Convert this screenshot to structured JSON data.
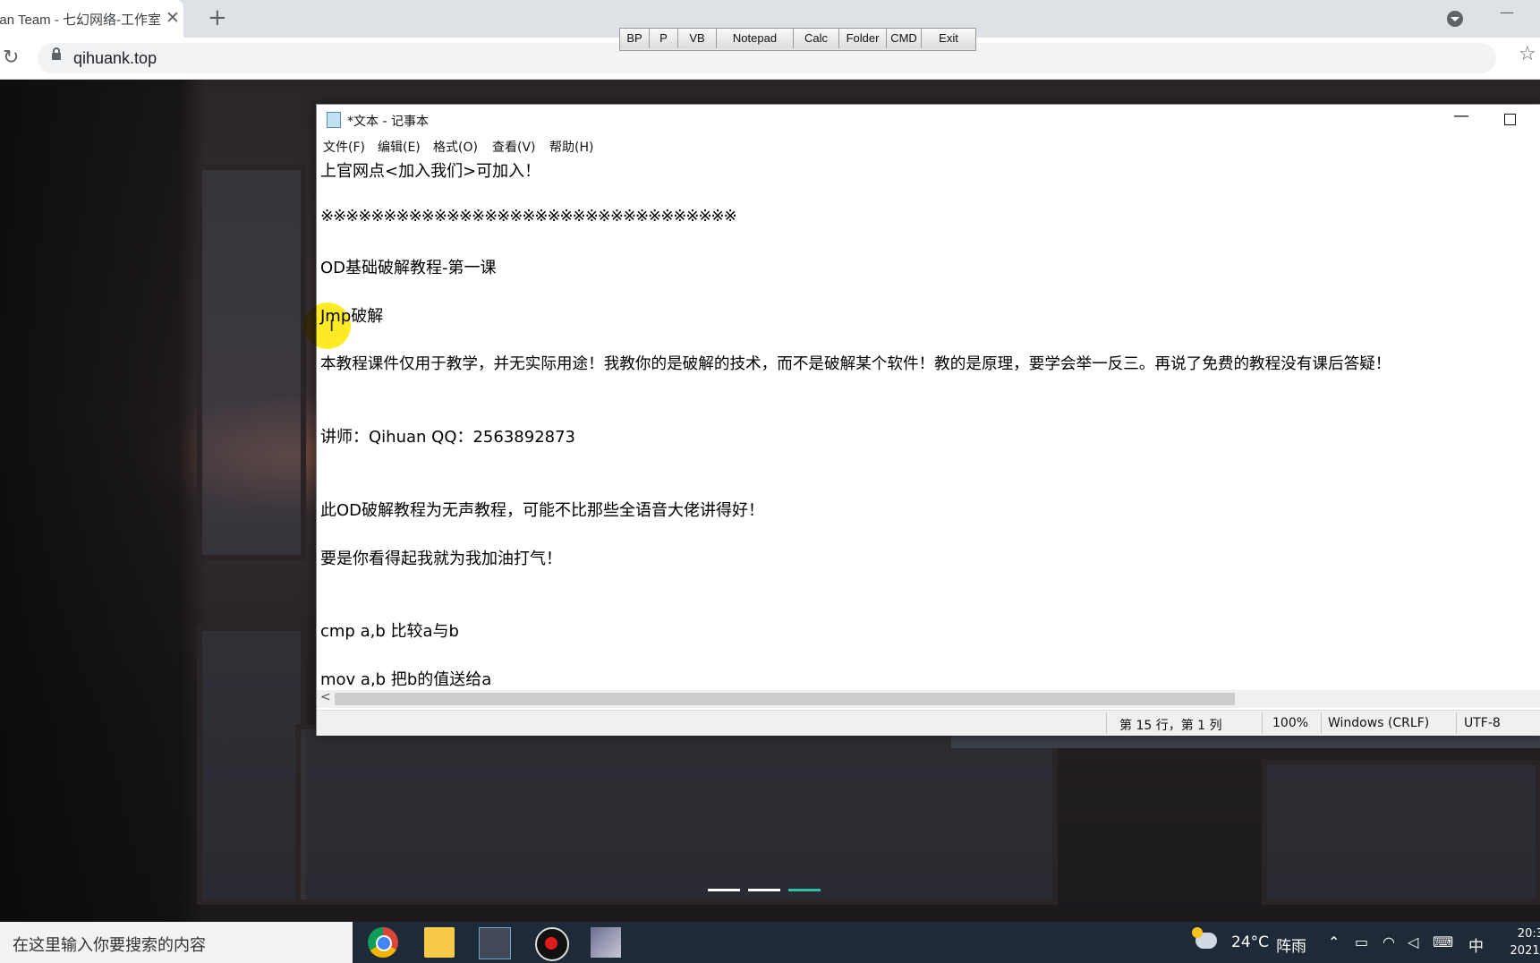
{
  "browser": {
    "tab_title": "qihuan Team - 七幻网络-工作室",
    "tab_close": "✕",
    "new_tab": "+",
    "reload": "↻",
    "url": "qihuank.top",
    "star": "☆",
    "minimize": "—"
  },
  "toolbar": {
    "buttons": [
      "BP",
      "P",
      "VB",
      "Notepad",
      "Calc",
      "Folder",
      "CMD",
      "Exit"
    ]
  },
  "notepad": {
    "title": "*文本 - 记事本",
    "minimize": "—",
    "menu": [
      "文件(F)",
      "编辑(E)",
      "格式(O)",
      "查看(V)",
      "帮助(H)"
    ],
    "lines": [
      "上官网点<加入我们>可加入！",
      "※※※※※※※※※※※※※※※※※※※※※※※※※※※※※※※※※",
      "OD基础破解教程-第一课",
      "Jmp破解",
      "本教程课件仅用于教学，并无实际用途！我教你的是破解的技术，而不是破解某个软件！教的是原理，要学会举一反三。再说了免费的教程没有课后答疑！",
      "讲师：Qihuan  QQ：2563892873",
      "此OD破解教程为无声教程，可能不比那些全语音大佬讲得好！",
      "要是你看得起我就为我加油打气！",
      "cmp a,b 比较a与b",
      "mov a,b 把b的值送给a"
    ],
    "scroll_left": "<",
    "status": {
      "position": "第 15 行，第 1 列",
      "zoom": "100%",
      "line_ending": "Windows (CRLF)",
      "encoding": "UTF-8"
    }
  },
  "slider": {
    "count": 3,
    "active_index": 2,
    "accent": "#2fbfa6"
  },
  "taskbar": {
    "search_placeholder": "在这里输入你要搜索的内容",
    "apps": [
      "chrome-icon",
      "file-explorer-icon",
      "notepad-icon",
      "screen-recorder-icon",
      "image-app-icon"
    ],
    "weather_temp": "24°C",
    "weather_desc": "阵雨",
    "ime": "中",
    "time": "20:3",
    "date": "2021/"
  }
}
